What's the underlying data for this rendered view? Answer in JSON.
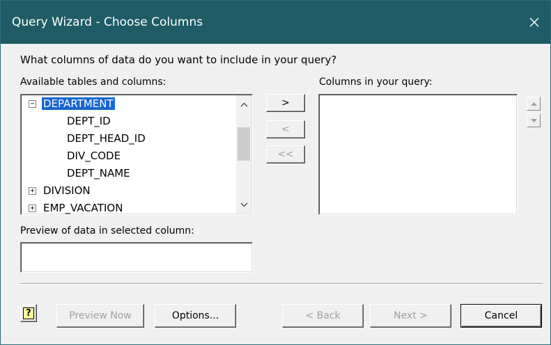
{
  "window": {
    "title": "Query Wizard - Choose Columns"
  },
  "prompt": "What columns of data do you want to include in your query?",
  "available": {
    "label": "Available tables and columns:",
    "items": [
      {
        "text": "DEPARTMENT",
        "expander": "−"
      },
      {
        "text": "DEPT_ID"
      },
      {
        "text": "DEPT_HEAD_ID"
      },
      {
        "text": "DIV_CODE"
      },
      {
        "text": "DEPT_NAME"
      },
      {
        "text": "DIVISION",
        "expander": "+"
      },
      {
        "text": "EMP_VACATION",
        "expander": "+"
      }
    ]
  },
  "move_buttons": {
    "add": ">",
    "remove": "<",
    "remove_all": "<<"
  },
  "query_columns": {
    "label": "Columns in your query:"
  },
  "preview": {
    "label": "Preview of data in selected column:",
    "value": ""
  },
  "footer": {
    "help": "?",
    "preview_now": "Preview Now",
    "options": "Options...",
    "back": "< Back",
    "next": "Next >",
    "cancel": "Cancel"
  },
  "colors": {
    "titlebar": "#1f5c66",
    "selection": "#1666cc"
  }
}
